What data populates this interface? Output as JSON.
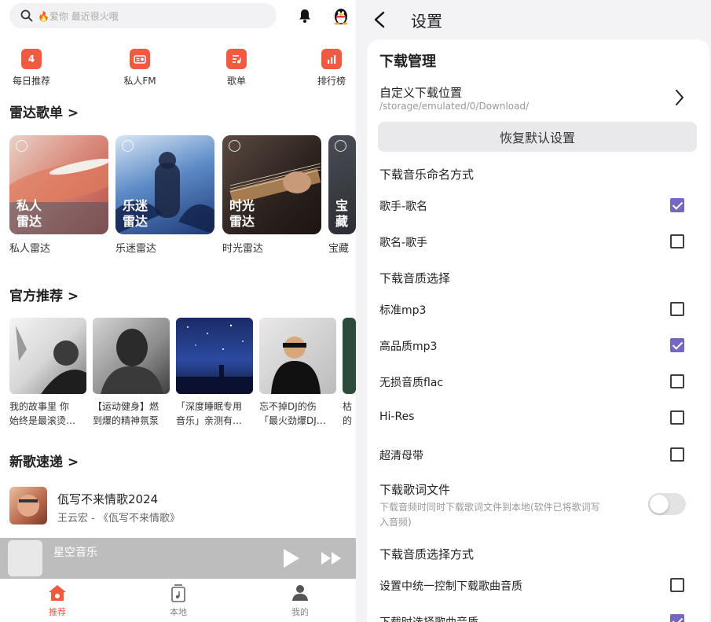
{
  "left": {
    "search": {
      "placeholder": "🔥爱你 最近很火哦"
    },
    "quick": [
      {
        "label": "每日推荐",
        "icon": "calendar-icon",
        "glyph": "4"
      },
      {
        "label": "私人FM",
        "icon": "radio-icon",
        "glyph": ""
      },
      {
        "label": "歌单",
        "icon": "playlist-icon",
        "glyph": ""
      },
      {
        "label": "排行榜",
        "icon": "chart-icon",
        "glyph": ""
      }
    ],
    "sections": {
      "radar": "雷达歌单 >",
      "official": "官方推荐 >",
      "new_songs": "新歌速递 >"
    },
    "radar_cards": [
      {
        "overlay": "私人雷达",
        "name": "私人雷达"
      },
      {
        "overlay": "乐迷雷达",
        "name": "乐迷雷达"
      },
      {
        "overlay": "时光雷达",
        "name": "时光雷达"
      },
      {
        "overlay": "宝藏",
        "name": "宝藏"
      }
    ],
    "official_cards": [
      {
        "line1": "我的故事里 你",
        "line2": "始终是最滚烫…"
      },
      {
        "line1": "【运动健身】燃",
        "line2": "到爆的精神氛泵"
      },
      {
        "line1": "「深度睡眠专用",
        "line2": "音乐」亲测有…"
      },
      {
        "line1": "忘不掉DJ的伤",
        "line2": "「最火劲爆DJ…"
      },
      {
        "line1": "枯",
        "line2": "的"
      }
    ],
    "song": {
      "title": "佤写不来情歌2024",
      "subtitle": "王云宏 - 《佤写不来情歌》"
    },
    "player": {
      "name": "星空音乐"
    },
    "tabs": [
      {
        "label": "推荐"
      },
      {
        "label": "本地"
      },
      {
        "label": "我的"
      }
    ],
    "colors": {
      "accent": "#f05a41"
    }
  },
  "right": {
    "title": "设置",
    "section1": "下载管理",
    "custom_path": {
      "label": "自定义下载位置",
      "value": "/storage/emulated/0/Download/"
    },
    "reset_label": "恢复默认设置",
    "naming": {
      "title": "下载音乐命名方式",
      "options": [
        {
          "label": "歌手-歌名",
          "checked": true
        },
        {
          "label": "歌名-歌手",
          "checked": false
        }
      ]
    },
    "quality": {
      "title": "下载音质选择",
      "options": [
        {
          "label": "标准mp3",
          "checked": false
        },
        {
          "label": "高品质mp3",
          "checked": true
        },
        {
          "label": "无损音质flac",
          "checked": false
        },
        {
          "label": "Hi-Res",
          "checked": false
        },
        {
          "label": "超清母带",
          "checked": false
        }
      ]
    },
    "lyrics": {
      "title": "下载歌词文件",
      "desc1": "下载音频时同时下载歌词文件到本地(软件已将歌词写",
      "desc2": "入音频)",
      "enabled": false
    },
    "quality_mode": {
      "title": "下载音质选择方式",
      "options": [
        {
          "label": "设置中统一控制下载歌曲音质",
          "checked": false
        },
        {
          "label": "下载时选择歌曲音质",
          "checked": true
        }
      ]
    },
    "colors": {
      "checkbox": "#7566c4"
    }
  }
}
